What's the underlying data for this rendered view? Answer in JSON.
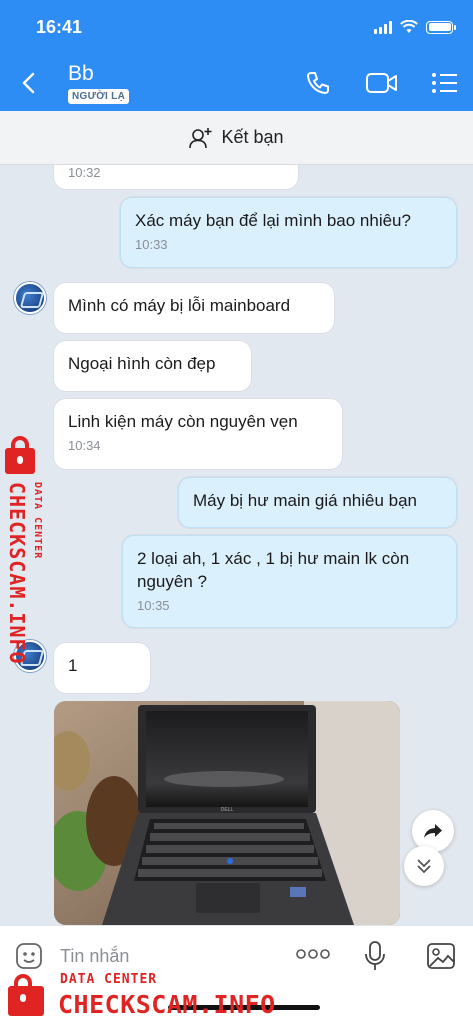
{
  "status_bar": {
    "time": "16:41"
  },
  "header": {
    "contact_name": "Bb",
    "badge": "NGƯỜI LẠ"
  },
  "friend_bar": {
    "label": "Kết bạn"
  },
  "messages": [
    {
      "side": "in",
      "text": "",
      "time": "10:32"
    },
    {
      "side": "out",
      "text": "Xác máy bạn để lại mình bao nhiêu?",
      "time": "10:33"
    },
    {
      "side": "in",
      "text": "Mình có máy bị lỗi mainboard",
      "time": ""
    },
    {
      "side": "in",
      "text": "Ngoại hình còn đẹp",
      "time": ""
    },
    {
      "side": "in",
      "text": "Linh kiện máy còn nguyên vẹn",
      "time": "10:34"
    },
    {
      "side": "out",
      "text": "Máy bị hư main giá nhiêu bạn",
      "time": ""
    },
    {
      "side": "out",
      "text": "2 loại ah, 1 xác , 1 bị hư main lk còn nguyên ?",
      "time": "10:35"
    },
    {
      "side": "in",
      "text": "1",
      "time": ""
    }
  ],
  "photo": {
    "brand_label": "DELL"
  },
  "input": {
    "placeholder": "Tin nhắn"
  },
  "watermark": {
    "small": "DATA CENTER",
    "big": "CHECKSCAM.INFO"
  },
  "icons": [
    "back-icon",
    "phone-icon",
    "video-icon",
    "menu-icon",
    "add-friend-icon",
    "sticker-icon",
    "more-icon",
    "mic-icon",
    "image-icon",
    "share-icon",
    "scroll-down-icon"
  ],
  "colors": {
    "header": "#2e8df5",
    "out_bubble": "#dbf0fd",
    "in_bubble": "#ffffff",
    "background": "#e2e8ef",
    "watermark": "#e02424"
  }
}
